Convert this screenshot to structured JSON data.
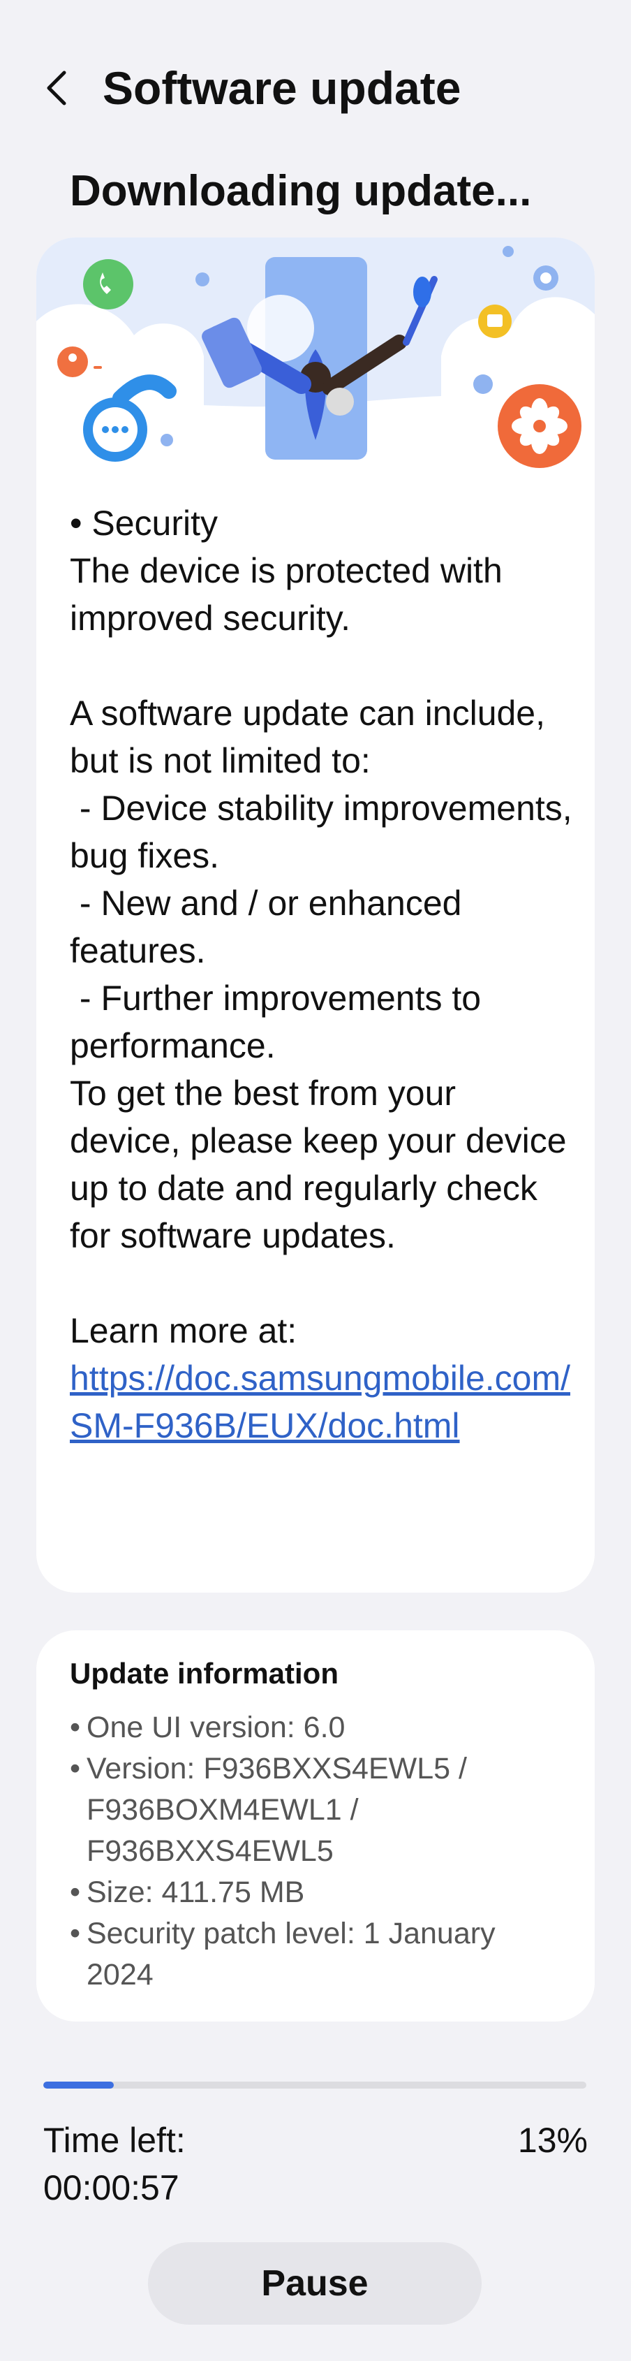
{
  "header": {
    "title": "Software update"
  },
  "status": {
    "title": "Downloading update..."
  },
  "notes": {
    "body": "• Security\nThe device is protected with improved security.\n\nA software update can include, but is not limited to:\n - Device stability improvements, bug fixes.\n - New and / or enhanced features.\n - Further improvements to performance.\nTo get the best from your device, please keep your device up to date and regularly check for software updates.\n\nLearn more at:\n",
    "link": "https://doc.samsungmobile.com/SM-F936B/EUX/doc.html"
  },
  "info": {
    "heading": "Update information",
    "items": [
      "One UI version: 6.0",
      "Version: F936BXXS4EWL5 / F936BOXM4EWL1 / F936BXXS4EWL5",
      "Size: 411.75 MB",
      "Security patch level: 1 January 2024"
    ]
  },
  "progress": {
    "percent_value": 13,
    "percent_label": "13%",
    "time_left_label": "Time left:",
    "time_left_value": "00:00:57"
  },
  "actions": {
    "pause_label": "Pause"
  },
  "colors": {
    "accent": "#3d6fe0",
    "link": "#2f62c7",
    "background": "#f2f2f6",
    "card": "#ffffff"
  }
}
